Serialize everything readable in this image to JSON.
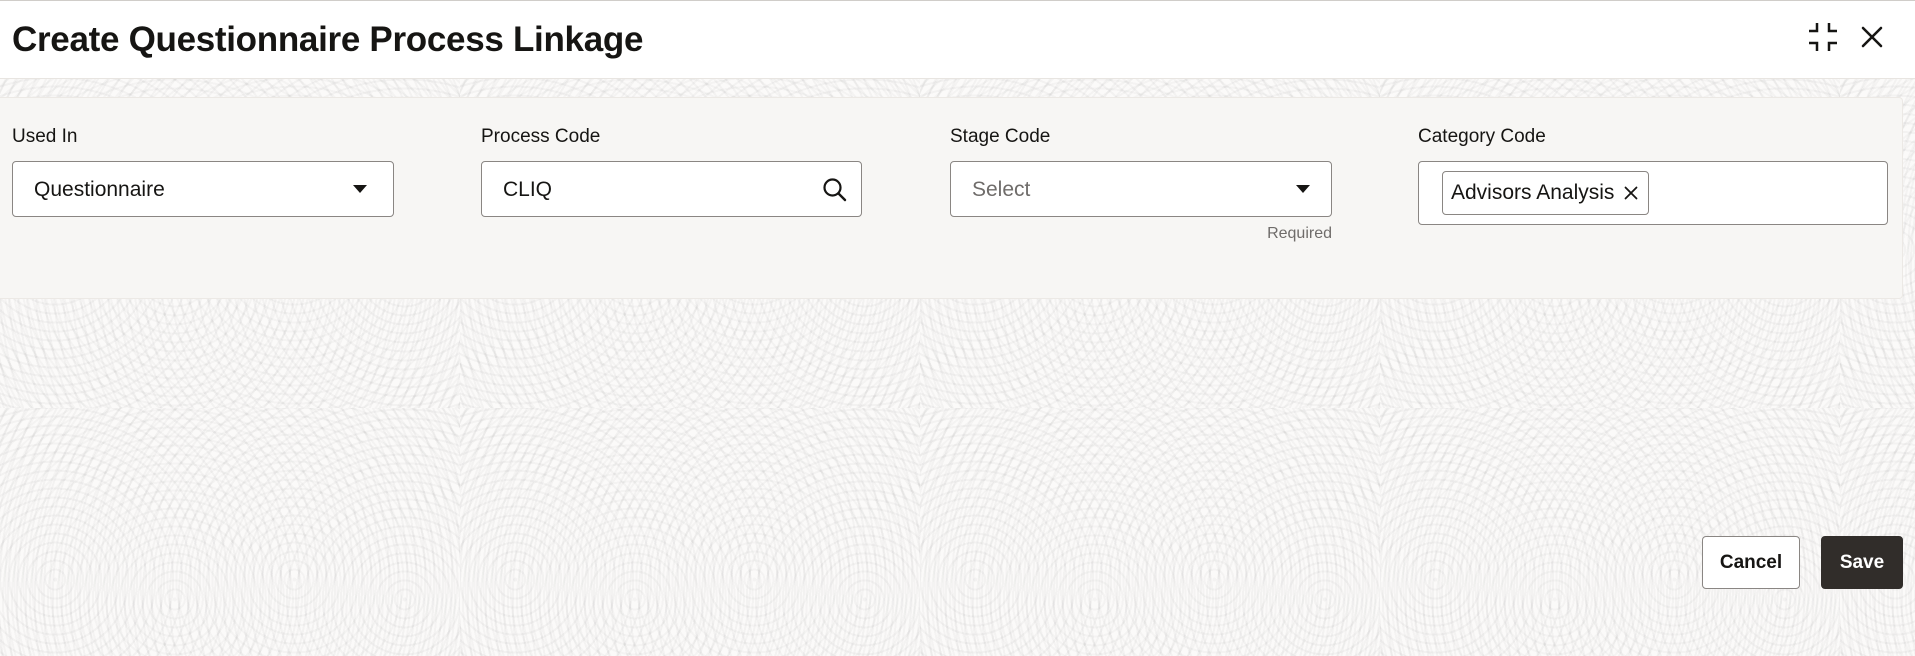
{
  "dialog": {
    "title": "Create Questionnaire Process Linkage",
    "icons": {
      "minimize": "compress-icon",
      "close": "close-icon"
    }
  },
  "form": {
    "used_in": {
      "label": "Used In",
      "value": "Questionnaire",
      "icon": "chevron-down-icon"
    },
    "process_code": {
      "label": "Process Code",
      "value": "CLIQ",
      "icon": "search-icon"
    },
    "stage_code": {
      "label": "Stage Code",
      "placeholder": "Select",
      "helper": "Required",
      "icon": "chevron-down-icon"
    },
    "category_code": {
      "label": "Category Code",
      "chips": [
        {
          "label": "Advisors Analysis",
          "remove_icon": "close-icon"
        }
      ]
    }
  },
  "footer": {
    "cancel_label": "Cancel",
    "save_label": "Save"
  },
  "colors": {
    "primary_button": "#312d2a",
    "panel": "#f7f6f4",
    "border": "#8a8683"
  }
}
